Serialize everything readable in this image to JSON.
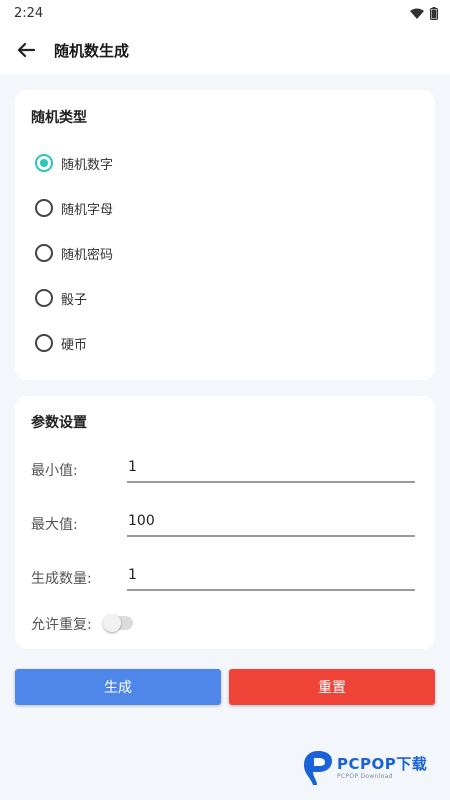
{
  "status_bar": {
    "time": "2:24",
    "icons": [
      "wifi-icon",
      "battery-icon"
    ]
  },
  "app_bar": {
    "title": "随机数生成",
    "back_icon": "arrow-left-icon"
  },
  "random_type": {
    "title": "随机类型",
    "options": [
      {
        "label": "随机数字",
        "checked": true
      },
      {
        "label": "随机字母",
        "checked": false
      },
      {
        "label": "随机密码",
        "checked": false
      },
      {
        "label": "骰子",
        "checked": false
      },
      {
        "label": "硬币",
        "checked": false
      }
    ],
    "accent_color": "#28c7b7"
  },
  "params": {
    "title": "参数设置",
    "min_label": "最小值:",
    "min_value": "1",
    "max_label": "最大值:",
    "max_value": "100",
    "count_label": "生成数量:",
    "count_value": "1",
    "allow_repeat_label": "允许重复:",
    "allow_repeat": false
  },
  "actions": {
    "generate_label": "生成",
    "generate_color": "#4f86ea",
    "reset_label": "重置",
    "reset_color": "#f04337"
  },
  "watermark": {
    "main": "PCPOP下载",
    "sub": "PCPOP Download"
  }
}
